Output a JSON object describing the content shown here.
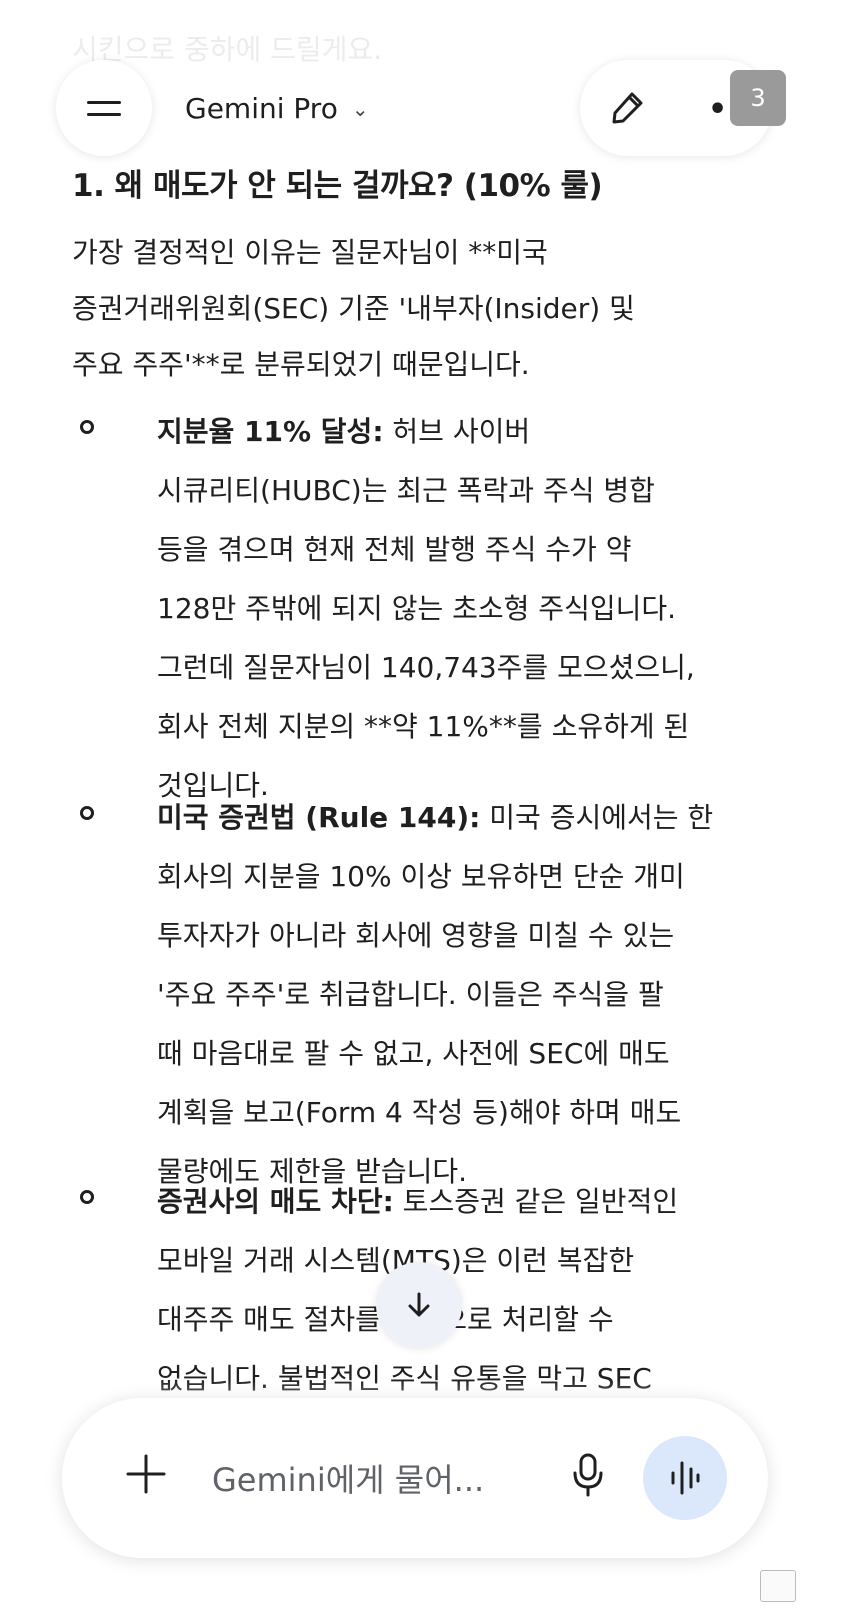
{
  "header": {
    "title": "Gemini Pro",
    "notification_count": "3"
  },
  "content": {
    "faded_line": "시킨으로 중하에 드릴게요.",
    "heading": "1. 왜 매도가 안 되는 걸까요? (10% 룰)",
    "intro_lines": [
      "가장 결정적인 이유는 질문자님이 **미국",
      "증권거래위원회(SEC) 기준 '내부자(Insider) 및",
      "주요 주주'**로 분류되었기 때문입니다."
    ],
    "bullets": [
      {
        "title": "지분율 11% 달성:",
        "lines": [
          " 허브 사이버",
          "시큐리티(HUBC)는 최근 폭락과 주식 병합",
          "등을 겪으며 현재 전체 발행 주식 수가 약",
          "128만 주밖에 되지 않는 초소형 주식입니다.",
          "그런데 질문자님이 140,743주를 모으셨으니,",
          "회사 전체 지분의 **약 11%**를 소유하게 된",
          "것입니다."
        ]
      },
      {
        "title": "미국 증권법 (Rule 144):",
        "lines": [
          " 미국 증시에서는 한",
          "회사의 지분을 10% 이상 보유하면 단순 개미",
          "투자자가 아니라 회사에 영향을 미칠 수 있는",
          "'주요 주주'로 취급합니다. 이들은 주식을 팔",
          "때 마음대로 팔 수 없고, 사전에 SEC에 매도",
          "계획을 보고(Form 4 작성 등)해야 하며 매도",
          "물량에도 제한을 받습니다."
        ]
      },
      {
        "title": "증권사의 매도 차단:",
        "lines": [
          " 토스증권 같은 일반적인",
          "모바일 거래 시스템(MTS)은 이런 복잡한",
          "대주주 매도 절차를 자동으로 처리할 수",
          "없습니다. 불법적인 주식 유통을 막고 SEC"
        ]
      }
    ]
  },
  "input": {
    "placeholder": "Gemini에게 물어..."
  },
  "icons": {
    "menu": "hamburger-menu-icon",
    "title_dropdown": "chevron-down-icon",
    "new_chat": "edit-pen-icon",
    "more": "more-options-icon",
    "scroll": "arrow-down-icon",
    "add": "plus-icon",
    "mic": "microphone-icon",
    "live": "live-audio-icon"
  }
}
